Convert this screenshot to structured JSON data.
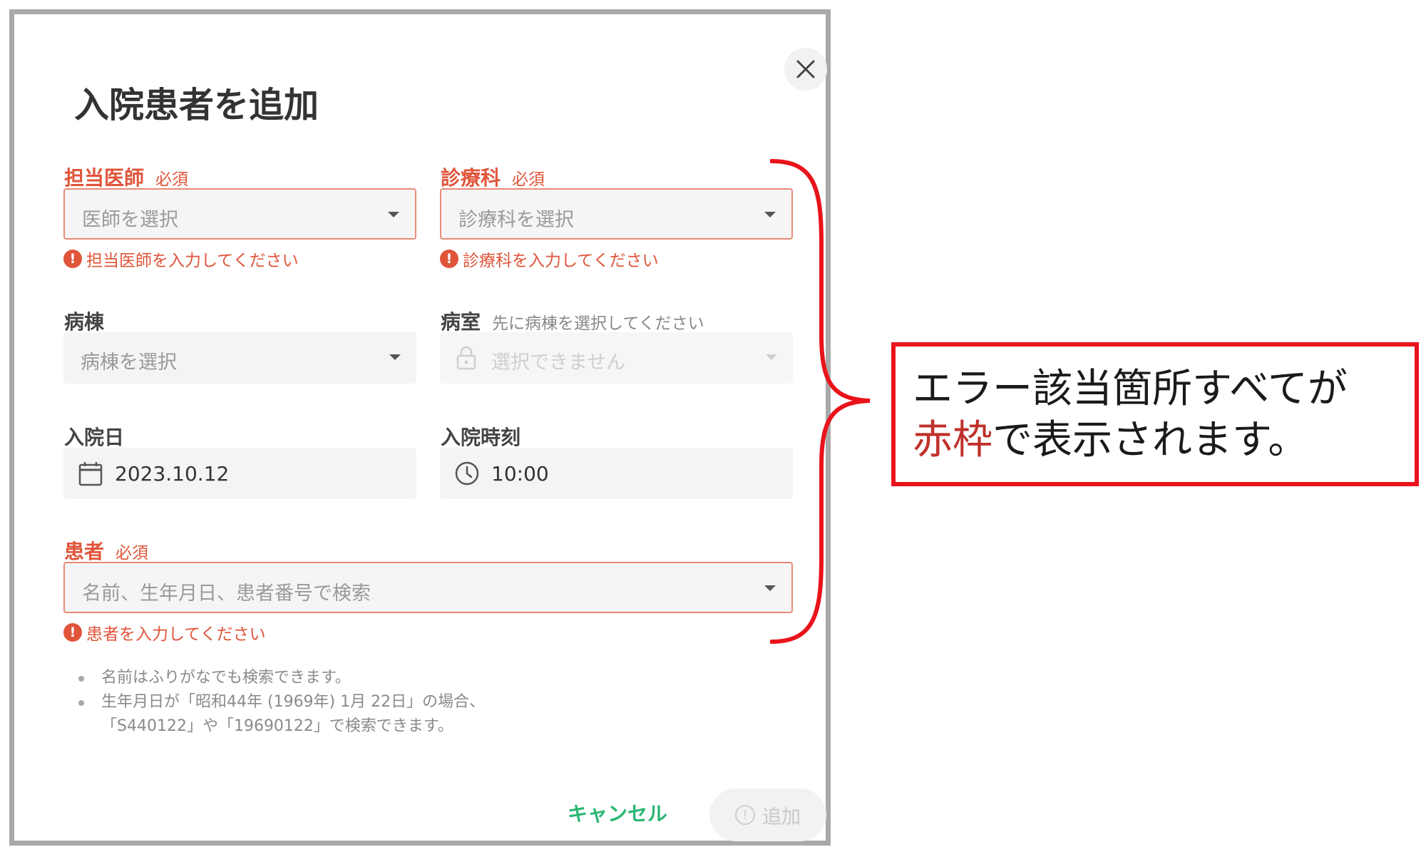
{
  "dialog": {
    "title": "入院患者を追加",
    "doctor": {
      "label": "担当医師",
      "required": "必須",
      "placeholder": "医師を選択",
      "error": "担当医師を入力してください"
    },
    "department": {
      "label": "診療科",
      "required": "必須",
      "placeholder": "診療科を選択",
      "error": "診療科を入力してください"
    },
    "ward": {
      "label": "病棟",
      "placeholder": "病棟を選択"
    },
    "room": {
      "label": "病室",
      "hint": "先に病棟を選択してください",
      "placeholder": "選択できません"
    },
    "admission_date": {
      "label": "入院日",
      "value": "2023.10.12"
    },
    "admission_time": {
      "label": "入院時刻",
      "value": "10:00"
    },
    "patient": {
      "label": "患者",
      "required": "必須",
      "placeholder": "名前、生年月日、患者番号で検索",
      "error": "患者を入力してください"
    },
    "notes": [
      "名前はふりがなでも検索できます。",
      "生年月日が「昭和44年 (1969年) 1月 22日」の場合、",
      "「S440122」や「19690122」で検索できます。"
    ],
    "cancel_label": "キャンセル",
    "add_label": "追加"
  },
  "annotation": {
    "line1": "エラー該当箇所すべてが",
    "line2_red": "赤枠",
    "line2_rest": "で表示されます。"
  },
  "colors": {
    "error": "#e0553a",
    "accent_green": "#2bb673",
    "annotation_red": "#e8131b"
  }
}
